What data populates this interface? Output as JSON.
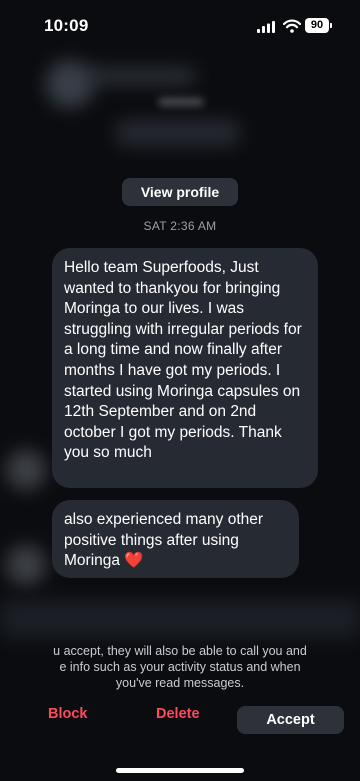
{
  "status_bar": {
    "time": "10:09",
    "battery": "90"
  },
  "profile": {
    "view_profile_label": "View profile"
  },
  "conversation": {
    "timestamp": "SAT 2:36 AM",
    "messages": [
      "Hello team Superfoods, Just wanted to thankyou for bringing Moringa to our lives. I was struggling with irregular periods for a long time and now finally after months I have got my periods. I started using Moringa capsules on 12th September and on 2nd october I got my periods. Thank you so much",
      "also experienced many other positive things after using Moringa"
    ],
    "message_2_emoji": "❤️"
  },
  "footer": {
    "info_line_1": "u accept, they will also be able to call you and",
    "info_line_2": "e info such as your activity status and when",
    "info_line_3": "you've read messages.",
    "block_label": "Block",
    "delete_label": "Delete",
    "accept_label": "Accept"
  },
  "colors": {
    "destructive": "#ff4a5c",
    "bubble": "#262a33",
    "button_bg": "#2d3139"
  }
}
